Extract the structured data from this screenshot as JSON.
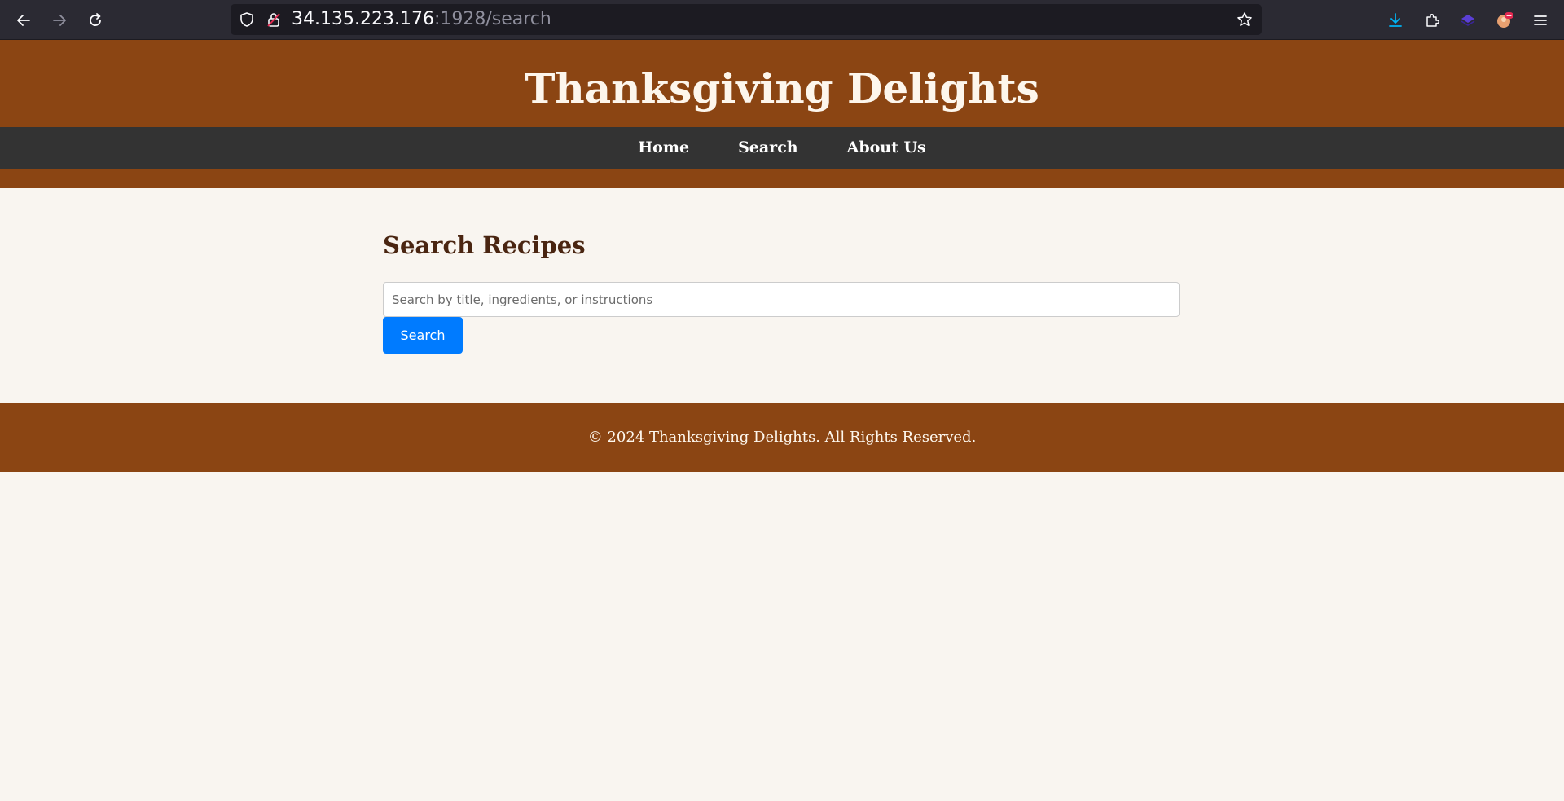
{
  "browser": {
    "url_host": "34.135.223.176",
    "url_rest": ":1928/search",
    "icons": {
      "back": "back-arrow-icon",
      "forward": "forward-arrow-icon",
      "reload": "reload-icon",
      "shield": "shield-icon",
      "lock": "insecure-lock-icon",
      "bookmark": "star-icon",
      "downloads": "download-icon",
      "extensions": "puzzle-icon",
      "extension_a": "layers-extension-icon",
      "profile": "avatar-icon",
      "menu": "hamburger-menu-icon"
    },
    "colors": {
      "toolbar": "#2b2a33",
      "urlbar": "#1c1b22",
      "download_accent": "#00b3f4"
    }
  },
  "site": {
    "title": "Thanksgiving Delights",
    "nav": [
      {
        "label": "Home"
      },
      {
        "label": "Search"
      },
      {
        "label": "About Us"
      }
    ],
    "colors": {
      "header": "#8b4513",
      "nav": "#333333",
      "page": "#f9f5f0",
      "heading": "#4a2511",
      "button": "#007bff"
    }
  },
  "main": {
    "heading": "Search Recipes",
    "search": {
      "placeholder": "Search by title, ingredients, or instructions",
      "value": "",
      "button_label": "Search"
    }
  },
  "footer": {
    "text": "© 2024 Thanksgiving Delights. All Rights Reserved."
  }
}
